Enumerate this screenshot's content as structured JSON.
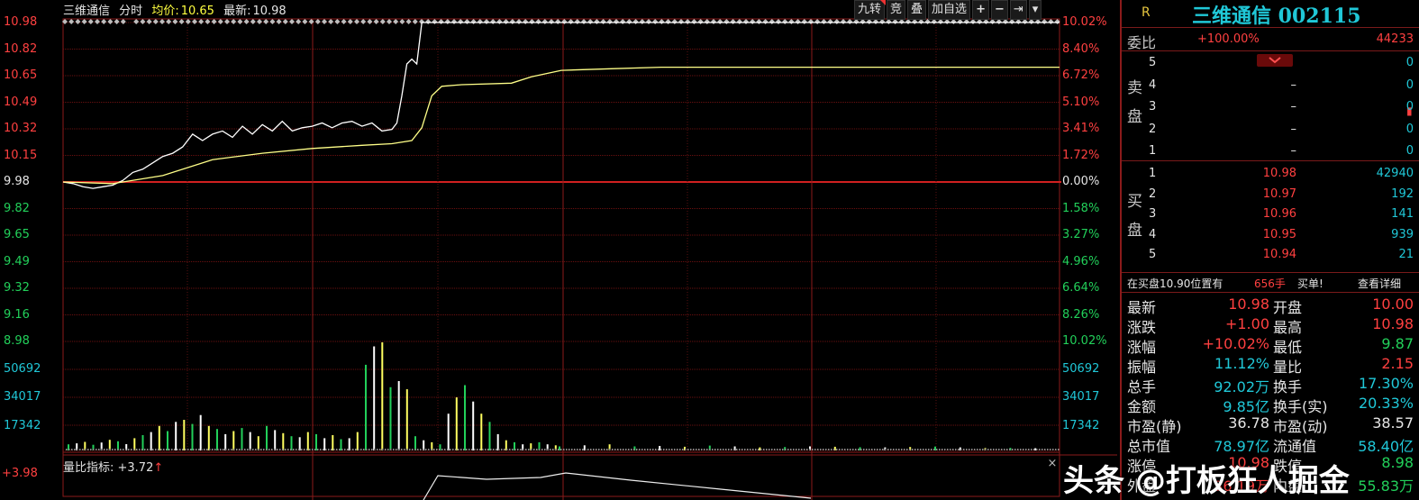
{
  "header": {
    "stock_name": "三维通信",
    "mode": "分时",
    "avg_label": "均价:",
    "avg_value": "10.65",
    "last_label": "最新:",
    "last_value": "10.98"
  },
  "toolbar": {
    "jiuzhuan": "九转",
    "jing": "竞",
    "die": "叠",
    "add_watch": "加自选",
    "plus": "+",
    "minus": "−",
    "next": "⇥",
    "more": "▾"
  },
  "price_axis_left": [
    "10.98",
    "10.82",
    "10.65",
    "10.49",
    "10.32",
    "10.15",
    "9.98",
    "9.82",
    "9.65",
    "9.49",
    "9.32",
    "9.16",
    "8.98"
  ],
  "price_axis_right": [
    "10.02%",
    "8.40%",
    "6.72%",
    "5.10%",
    "3.41%",
    "1.72%",
    "0.00%",
    "1.58%",
    "3.27%",
    "4.96%",
    "6.64%",
    "8.26%",
    "10.02%"
  ],
  "volume_axis": [
    "50692",
    "34017",
    "17342"
  ],
  "volume_indicator": {
    "label": "量比指标: +3.72",
    "arrow": "↑"
  },
  "bottom_left_value": "+3.98",
  "close_sub": "×",
  "chart_data": {
    "type": "line",
    "series": [
      {
        "name": "",
        "color": "#ffffff",
        "kind": "price",
        "x": [
          0,
          0.01,
          0.02,
          0.03,
          0.04,
          0.05,
          0.06,
          0.07,
          0.08,
          0.09,
          0.1,
          0.11,
          0.12,
          0.13,
          0.14,
          0.15,
          0.16,
          0.17,
          0.18,
          0.19,
          0.2,
          0.21,
          0.22,
          0.23,
          0.24,
          0.25,
          0.26,
          0.27,
          0.28,
          0.29,
          0.3,
          0.31,
          0.32,
          0.33,
          0.335,
          0.34,
          0.345,
          0.35,
          0.355,
          0.36,
          0.365,
          0.37,
          0.5,
          0.6,
          0.7,
          0.8,
          0.9,
          1.0
        ],
        "y": [
          9.98,
          9.97,
          9.95,
          9.94,
          9.95,
          9.96,
          9.99,
          10.04,
          10.06,
          10.1,
          10.14,
          10.16,
          10.2,
          10.28,
          10.24,
          10.28,
          10.3,
          10.26,
          10.33,
          10.28,
          10.34,
          10.3,
          10.36,
          10.3,
          10.32,
          10.33,
          10.35,
          10.32,
          10.35,
          10.36,
          10.33,
          10.35,
          10.3,
          10.31,
          10.35,
          10.52,
          10.72,
          10.75,
          10.72,
          10.98,
          10.98,
          10.98,
          10.98,
          10.98,
          10.98,
          10.98,
          10.98,
          10.98
        ]
      },
      {
        "name": "",
        "color": "#ffff88",
        "kind": "avg",
        "x": [
          0,
          0.05,
          0.1,
          0.15,
          0.2,
          0.25,
          0.3,
          0.33,
          0.35,
          0.36,
          0.37,
          0.38,
          0.4,
          0.45,
          0.47,
          0.5,
          0.55,
          0.6,
          0.7,
          0.8,
          0.9,
          1.0
        ],
        "y": [
          9.98,
          9.97,
          10.02,
          10.12,
          10.16,
          10.19,
          10.21,
          10.22,
          10.24,
          10.32,
          10.52,
          10.58,
          10.59,
          10.6,
          10.64,
          10.68,
          10.69,
          10.7,
          10.7,
          10.7,
          10.7,
          10.7
        ]
      }
    ],
    "volume": [
      3000,
      3500,
      4200,
      2800,
      3900,
      5200,
      4500,
      3100,
      6000,
      7500,
      9000,
      12000,
      9500,
      14000,
      15000,
      13000,
      17342,
      12000,
      10500,
      8000,
      9500,
      11000,
      9000,
      7000,
      12000,
      10000,
      8500,
      7000,
      6500,
      9000,
      8000,
      6000,
      7500,
      5500,
      6000,
      9000,
      42000,
      51000,
      53000,
      31000,
      34017,
      30000,
      7000,
      5000,
      4000,
      3000,
      18000,
      26000,
      32000,
      24000,
      18000,
      14000,
      8000,
      5000,
      4000,
      3000,
      3500,
      4000,
      3000,
      2500,
      2000,
      2500,
      3000,
      2000,
      2200,
      1800,
      2400,
      2000,
      1500,
      1700,
      2000,
      1800,
      1600,
      1500,
      1700,
      1900,
      1500,
      1200,
      1300,
      1100
    ],
    "ylim": [
      8.98,
      10.98
    ],
    "ref_price": 9.98,
    "volume_ticks": [
      50692,
      34017,
      17342
    ]
  },
  "quote": {
    "r_label": "R",
    "title": "三维通信 002115",
    "weibi_label": "委比",
    "weibi_value": "+100.00%",
    "weibi_diff": "44233",
    "sell_group": "卖盘",
    "buy_group": "买盘",
    "sell": [
      {
        "level": "5",
        "price": "",
        "vol": "0"
      },
      {
        "level": "4",
        "price": "–",
        "vol": "0"
      },
      {
        "level": "3",
        "price": "–",
        "vol": "0"
      },
      {
        "level": "2",
        "price": "–",
        "vol": "0"
      },
      {
        "level": "1",
        "price": "–",
        "vol": "0"
      }
    ],
    "buy": [
      {
        "level": "1",
        "price": "10.98",
        "vol": "42940"
      },
      {
        "level": "2",
        "price": "10.97",
        "vol": "192"
      },
      {
        "level": "3",
        "price": "10.96",
        "vol": "141"
      },
      {
        "level": "4",
        "price": "10.95",
        "vol": "939"
      },
      {
        "level": "5",
        "price": "10.94",
        "vol": "21"
      }
    ],
    "notice_prefix": "在买盘10.90位置有",
    "notice_qty": "656手",
    "notice_action": "买单!",
    "notice_link": "查看详细",
    "stats": [
      {
        "l1": "最新",
        "v1": "10.98",
        "c1": "red",
        "l2": "开盘",
        "v2": "10.00",
        "c2": "red"
      },
      {
        "l1": "涨跌",
        "v1": "+1.00",
        "c1": "red",
        "l2": "最高",
        "v2": "10.98",
        "c2": "red"
      },
      {
        "l1": "涨幅",
        "v1": "+10.02%",
        "c1": "red",
        "l2": "最低",
        "v2": "9.87",
        "c2": "green"
      },
      {
        "l1": "振幅",
        "v1": "11.12%",
        "c1": "cyan",
        "l2": "量比",
        "v2": "2.15",
        "c2": "red"
      },
      {
        "l1": "总手",
        "v1": "92.02万",
        "c1": "cyan",
        "l2": "换手",
        "v2": "17.30%",
        "c2": "cyan"
      },
      {
        "l1": "金额",
        "v1": "9.85亿",
        "c1": "cyan",
        "l2": "换手(实)",
        "v2": "20.33%",
        "c2": "cyan"
      },
      {
        "l1": "市盈(静)",
        "v1": "36.78",
        "c1": "white",
        "l2": "市盈(动)",
        "v2": "38.57",
        "c2": "white"
      },
      {
        "l1": "总市值",
        "v1": "78.97亿",
        "c1": "cyan",
        "l2": "流通值",
        "v2": "58.40亿",
        "c2": "cyan"
      },
      {
        "l1": "涨停",
        "v1": "10.98",
        "c1": "red",
        "l2": "跌停",
        "v2": "8.98",
        "c2": "green"
      },
      {
        "l1": "外盘",
        "v1": "36.19万",
        "c1": "red",
        "l2": "内盘",
        "v2": "55.83万",
        "c2": "green"
      }
    ]
  },
  "watermark": {
    "text": "头条 @打板狂人掘金"
  }
}
